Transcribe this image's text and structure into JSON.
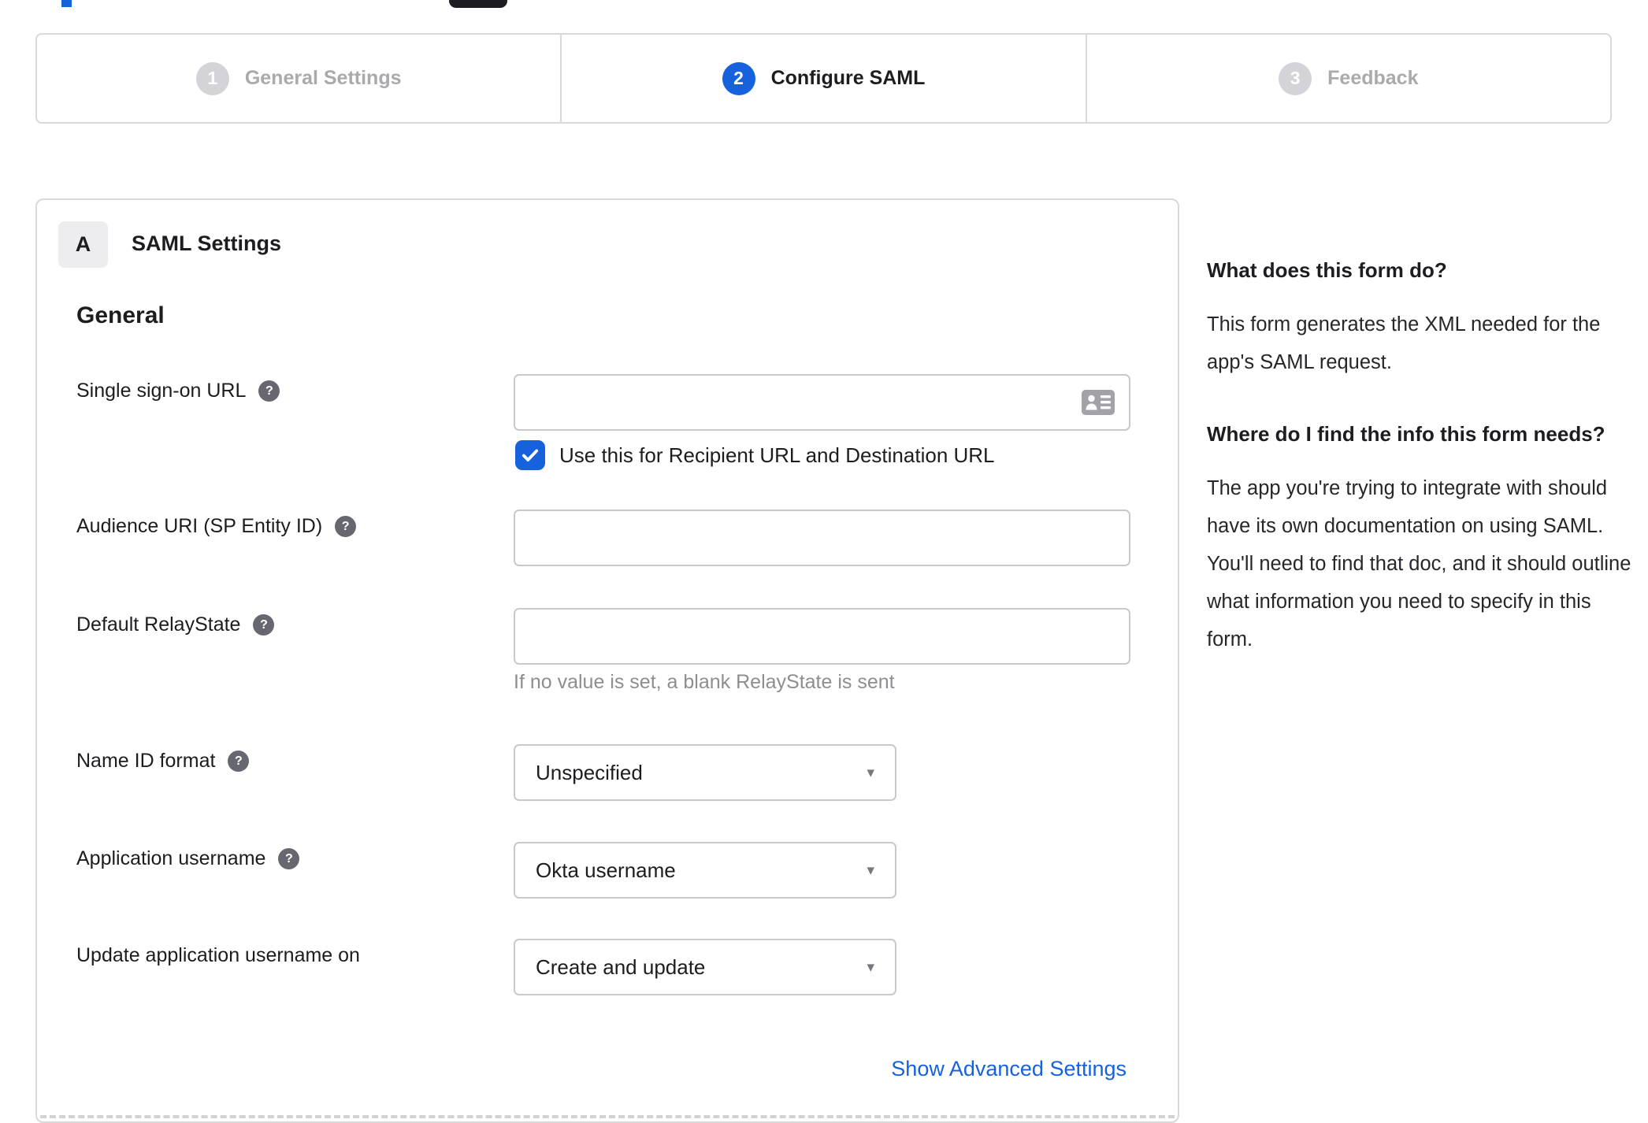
{
  "stepper": {
    "steps": [
      {
        "number": "1",
        "label": "General Settings",
        "state": "inactive"
      },
      {
        "number": "2",
        "label": "Configure SAML",
        "state": "active"
      },
      {
        "number": "3",
        "label": "Feedback",
        "state": "inactive"
      }
    ]
  },
  "saml_card": {
    "badge": "A",
    "title": "SAML Settings",
    "general_heading": "General",
    "fields": {
      "sso_url": {
        "label": "Single sign-on URL",
        "value": "",
        "placeholder": ""
      },
      "sso_use_for": {
        "label": "Use this for Recipient URL and Destination URL",
        "checked": true
      },
      "audience_uri": {
        "label": "Audience URI (SP Entity ID)",
        "value": "",
        "placeholder": ""
      },
      "default_relay_state": {
        "label": "Default RelayState",
        "value": "",
        "placeholder": "",
        "hint": "If no value is set, a blank RelayState is sent"
      },
      "name_id_format": {
        "label": "Name ID format",
        "selected": "Unspecified"
      },
      "application_username": {
        "label": "Application username",
        "selected": "Okta username"
      },
      "update_application_username_on": {
        "label": "Update application username on",
        "selected": "Create and update"
      }
    },
    "advanced_settings_link": "Show Advanced Settings"
  },
  "help_panel": {
    "sections": [
      {
        "title": "What does this form do?",
        "body": "This form generates the XML needed for the app's SAML request."
      },
      {
        "title": "Where do I find the info this form needs?",
        "body": "The app you're trying to integrate with should have its own documentation on using SAML. You'll need to find that doc, and it should outline what information you need to specify in this form."
      }
    ]
  },
  "icons": {
    "help_glyph": "?",
    "dropdown_arrow": "▾",
    "sso_input_icon": "contact-card",
    "checkbox_icon": "checkmark"
  },
  "colors": {
    "accent_blue": "#1662dd",
    "active_text": "#1d1d21",
    "inactive_gray": "#a9a9ae",
    "step_circle_inactive": "#d3d3d8",
    "hint_gray": "#8d8d93",
    "border_light": "#d9d9d9",
    "help_icon_bg": "#67676f"
  }
}
